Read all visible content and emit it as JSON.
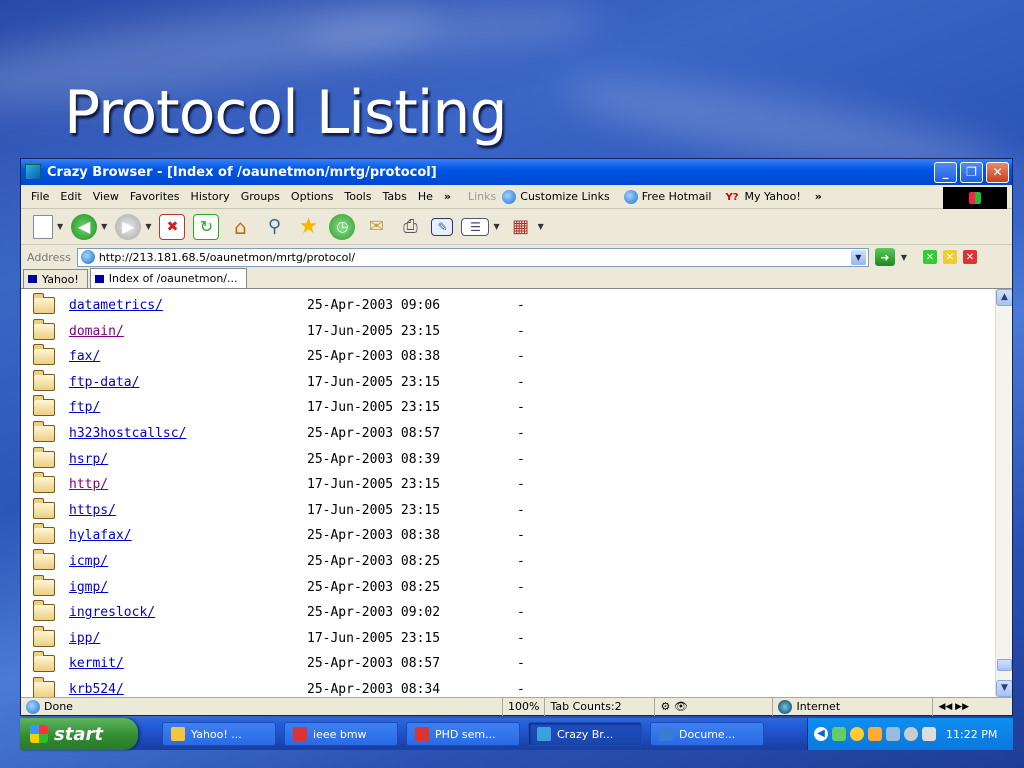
{
  "slide": {
    "title": "Protocol Listing"
  },
  "window": {
    "title": "Crazy Browser - [Index of /oaunetmon/mrtg/protocol]",
    "buttons": {
      "minimize": "_",
      "restore": "❐",
      "close": "✕"
    }
  },
  "menu": {
    "items": [
      "File",
      "Edit",
      "View",
      "Favorites",
      "History",
      "Groups",
      "Options",
      "Tools",
      "Tabs",
      "He"
    ],
    "overflow": "»",
    "links_label": "Links",
    "links": [
      "Customize Links",
      "Free Hotmail",
      "My Yahoo!"
    ],
    "links_overflow": "»"
  },
  "toolbar": {
    "icons": [
      "new-page-icon",
      "back-icon",
      "forward-icon",
      "stop-icon",
      "refresh-icon",
      "home-icon",
      "search-icon",
      "favorites-icon",
      "history-icon",
      "mail-icon",
      "print-icon",
      "edit-icon",
      "discuss-icon",
      "messenger-icon"
    ]
  },
  "address": {
    "label": "Address",
    "url": "http://213.181.68.5/oaunetmon/mrtg/protocol/"
  },
  "tabs": [
    {
      "label": "Yahoo!"
    },
    {
      "label": "Index of /oaunetmon/..."
    }
  ],
  "listing": [
    {
      "name": "datametrics/",
      "date": "25-Apr-2003 09:06",
      "size": "-",
      "visited": false
    },
    {
      "name": "domain/",
      "date": "17-Jun-2005 23:15",
      "size": "-",
      "visited": true
    },
    {
      "name": "fax/",
      "date": "25-Apr-2003 08:38",
      "size": "-",
      "visited": false
    },
    {
      "name": "ftp-data/",
      "date": "17-Jun-2005 23:15",
      "size": "-",
      "visited": false
    },
    {
      "name": "ftp/",
      "date": "17-Jun-2005 23:15",
      "size": "-",
      "visited": false
    },
    {
      "name": "h323hostcallsc/",
      "date": "25-Apr-2003 08:57",
      "size": "-",
      "visited": false
    },
    {
      "name": "hsrp/",
      "date": "25-Apr-2003 08:39",
      "size": "-",
      "visited": false
    },
    {
      "name": "http/",
      "date": "17-Jun-2005 23:15",
      "size": "-",
      "visited": true
    },
    {
      "name": "https/",
      "date": "17-Jun-2005 23:15",
      "size": "-",
      "visited": false
    },
    {
      "name": "hylafax/",
      "date": "25-Apr-2003 08:38",
      "size": "-",
      "visited": false
    },
    {
      "name": "icmp/",
      "date": "25-Apr-2003 08:25",
      "size": "-",
      "visited": false
    },
    {
      "name": "igmp/",
      "date": "25-Apr-2003 08:25",
      "size": "-",
      "visited": false
    },
    {
      "name": "ingreslock/",
      "date": "25-Apr-2003 09:02",
      "size": "-",
      "visited": false
    },
    {
      "name": "ipp/",
      "date": "17-Jun-2005 23:15",
      "size": "-",
      "visited": false
    },
    {
      "name": "kermit/",
      "date": "25-Apr-2003 08:57",
      "size": "-",
      "visited": false
    },
    {
      "name": "krb524/",
      "date": "25-Apr-2003 08:34",
      "size": "-",
      "visited": false
    }
  ],
  "status": {
    "text": "Done",
    "zoom": "100%",
    "tab_counts": "Tab Counts:2",
    "zone": "Internet"
  },
  "taskbar": {
    "start": "start",
    "items": [
      {
        "label": "Yahoo! ...",
        "active": false
      },
      {
        "label": "ieee bmw",
        "active": false
      },
      {
        "label": "PHD sem...",
        "active": false
      },
      {
        "label": "Crazy Br...",
        "active": true
      },
      {
        "label": "Docume...",
        "active": false
      }
    ],
    "clock": "11:22 PM"
  }
}
